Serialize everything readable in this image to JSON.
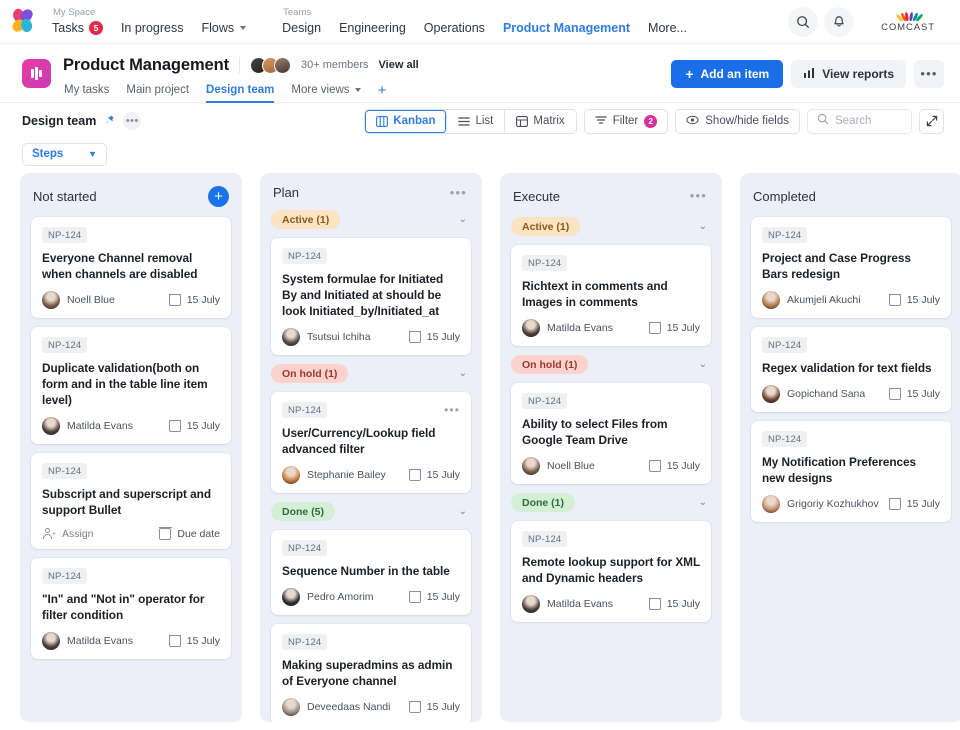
{
  "topnav": {
    "logo_name": "butterfly-logo",
    "myspace_label": "My Space",
    "teams_label": "Teams",
    "myspace_items": [
      {
        "label": "Tasks",
        "badge": "5",
        "active": false,
        "caret": false
      },
      {
        "label": "In progress",
        "badge": "",
        "active": false,
        "caret": false
      },
      {
        "label": "Flows",
        "badge": "",
        "active": false,
        "caret": true
      }
    ],
    "team_items": [
      {
        "label": "Design",
        "active": false
      },
      {
        "label": "Engineering",
        "active": false
      },
      {
        "label": "Operations",
        "active": false
      },
      {
        "label": "Product Management",
        "active": true
      },
      {
        "label": "More...",
        "active": false
      }
    ],
    "search_icon": "search-icon",
    "bell_icon": "bell-icon",
    "org_name": "COMCAST"
  },
  "project": {
    "title": "Product Management",
    "members_text": "30+ members",
    "view_all_label": "View all",
    "tabs": [
      {
        "label": "My tasks",
        "active": false,
        "caret": false
      },
      {
        "label": "Main project",
        "active": false,
        "caret": false
      },
      {
        "label": "Design team",
        "active": true,
        "caret": false
      },
      {
        "label": "More views",
        "active": false,
        "caret": true
      }
    ],
    "add_tab_label": "+",
    "add_item_label": "Add an item",
    "view_reports_label": "View reports",
    "more_label": "•••"
  },
  "toolbar": {
    "view_name": "Design team",
    "pin_icon": "pin-icon",
    "more_icon": "ellipsis-icon",
    "views": [
      {
        "label": "Kanban",
        "icon": "kanban-icon",
        "active": true
      },
      {
        "label": "List",
        "icon": "list-icon",
        "active": false
      },
      {
        "label": "Matrix",
        "icon": "matrix-icon",
        "active": false
      }
    ],
    "filter_label": "Filter",
    "filter_count": "2",
    "show_hide_label": "Show/hide fields",
    "search_placeholder": "Search",
    "search_value": "",
    "expand_icon": "expand-icon"
  },
  "steps": {
    "label": "Steps"
  },
  "board": {
    "columns": [
      {
        "title": "Not started",
        "action": "add",
        "groups": [
          {
            "pill": "",
            "cards": [
              {
                "key": "NP-124",
                "title": "Everyone Channel removal when channels are disabled",
                "assignee": "Noell Blue",
                "avatar_color": "#7a5c4a",
                "due": "15 July",
                "has_dots": false
              },
              {
                "key": "NP-124",
                "title": "Duplicate validation(both on form and in the table line item level)",
                "assignee": "Matilda Evans",
                "avatar_color": "#4a3f3a",
                "due": "15 July",
                "has_dots": false
              },
              {
                "key": "NP-124",
                "title": "Subscript and superscript  and support Bullet",
                "assignee": "Assign",
                "avatar_color": "",
                "due": "Due date",
                "has_dots": false,
                "empty_assignee": true
              },
              {
                "key": "NP-124",
                "title": "\"In\" and \"Not in\" operator for filter condition",
                "assignee": "Matilda Evans",
                "avatar_color": "#4a3f3a",
                "due": "15 July",
                "has_dots": false
              }
            ]
          }
        ]
      },
      {
        "title": "Plan",
        "action": "dots",
        "groups": [
          {
            "pill": "Active (1)",
            "pill_style": "g-active",
            "cards": [
              {
                "key": "NP-124",
                "title": "System formulae for Initiated By and Initiated at should be look Initiated_by/Initiated_at",
                "assignee": "Tsutsui Ichiha",
                "avatar_color": "#564a44",
                "due": "15 July",
                "has_dots": false
              }
            ]
          },
          {
            "pill": "On hold (1)",
            "pill_style": "g-hold",
            "cards": [
              {
                "key": "NP-124",
                "title": "User/Currency/Lookup field advanced filter",
                "assignee": "Stephanie Bailey",
                "avatar_color": "#c77a3a",
                "due": "15 July",
                "has_dots": true
              }
            ]
          },
          {
            "pill": "Done (5)",
            "pill_style": "g-done",
            "cards": [
              {
                "key": "NP-124",
                "title": "Sequence Number in the table",
                "assignee": "Pedro Amorim",
                "avatar_color": "#2e2e36",
                "due": "15 July",
                "has_dots": false
              },
              {
                "key": "NP-124",
                "title": "Making superadmins as admin of Everyone channel",
                "assignee": "Deveedaas Nandi",
                "avatar_color": "#9b8a7e",
                "due": "15 July",
                "has_dots": false
              }
            ]
          }
        ]
      },
      {
        "title": "Execute",
        "action": "dots",
        "groups": [
          {
            "pill": "Active (1)",
            "pill_style": "g-active",
            "cards": [
              {
                "key": "NP-124",
                "title": "Richtext in comments and Images in comments",
                "assignee": "Matilda Evans",
                "avatar_color": "#4a3f3a",
                "due": "15 July",
                "has_dots": false
              }
            ]
          },
          {
            "pill": "On hold (1)",
            "pill_style": "g-hold",
            "cards": [
              {
                "key": "NP-124",
                "title": "Ability to select Files from Google Team Drive",
                "assignee": "Noell Blue",
                "avatar_color": "#7a5c4a",
                "due": "15 July",
                "has_dots": false
              }
            ]
          },
          {
            "pill": "Done (1)",
            "pill_style": "g-done",
            "cards": [
              {
                "key": "NP-124",
                "title": "Remote lookup support for XML and Dynamic headers",
                "assignee": "Matilda Evans",
                "avatar_color": "#4a3f3a",
                "due": "15 July",
                "has_dots": false
              }
            ]
          }
        ]
      },
      {
        "title": "Completed",
        "action": "none",
        "groups": [
          {
            "pill": "",
            "cards": [
              {
                "key": "NP-124",
                "title": "Project and Case Progress Bars redesign",
                "assignee": "Akumjeli Akuchi",
                "avatar_color": "#b07b4a",
                "due": "15 July",
                "has_dots": false
              },
              {
                "key": "NP-124",
                "title": "Regex validation for text fields",
                "assignee": "Gopichand Sana",
                "avatar_color": "#6e4433",
                "due": "15 July",
                "has_dots": false
              },
              {
                "key": "NP-124",
                "title": "My Notification Preferences new designs",
                "assignee": "Grigoriy Kozhukhov",
                "avatar_color": "#c08a6a",
                "due": "15 July",
                "has_dots": false
              }
            ]
          }
        ]
      }
    ]
  },
  "colors": {
    "accent_blue": "#2f7de1",
    "primary_button": "#1a6fe8",
    "column_bg": "#eceef8",
    "filter_badge": "#d6329b",
    "tasks_badge": "#e02d4e"
  }
}
